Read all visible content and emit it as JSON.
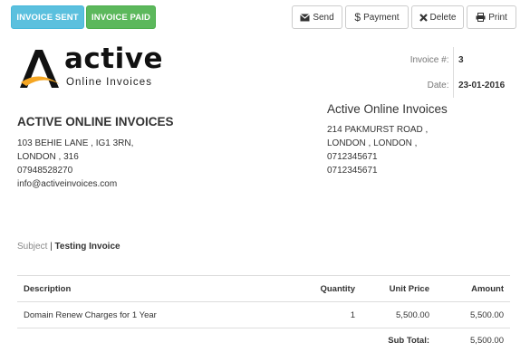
{
  "status_buttons": {
    "sent": "INVOICE SENT",
    "paid": "INVOICE PAID"
  },
  "actions": {
    "send": "Send",
    "payment": "Payment",
    "delete": "Delete",
    "print": "Print"
  },
  "logo": {
    "word": "active",
    "tagline": "Online Invoices"
  },
  "meta": {
    "invoice_label": "Invoice #:",
    "invoice_value": "3",
    "date_label": "Date:",
    "date_value": "23-01-2016"
  },
  "from": {
    "name": "ACTIVE ONLINE INVOICES",
    "lines": [
      "103 BEHIE LANE , IG1 3RN,",
      "LONDON , 316",
      "07948528270",
      "info@activeinvoices.com"
    ]
  },
  "to": {
    "name": "Active Online Invoices",
    "lines": [
      "214 PAKMURST ROAD ,",
      "LONDON , LONDON ,",
      "0712345671",
      "0712345671"
    ]
  },
  "subject": {
    "label": "Subject",
    "separator": "|",
    "value": "Testing Invoice"
  },
  "items_table": {
    "headers": [
      "Description",
      "Quantity",
      "Unit Price",
      "Amount"
    ],
    "rows": [
      {
        "description": "Domain Renew Charges for 1 Year",
        "quantity": "1",
        "unit_price": "5,500.00",
        "amount": "5,500.00"
      }
    ],
    "subtotal_label": "Sub Total:",
    "subtotal_value": "5,500.00"
  },
  "colors": {
    "sent": "#5bc0de",
    "paid": "#5cb85c",
    "logo_orange": "#f5a623"
  },
  "icons": [
    "envelope-icon",
    "dollar-icon",
    "times-icon",
    "print-icon"
  ]
}
